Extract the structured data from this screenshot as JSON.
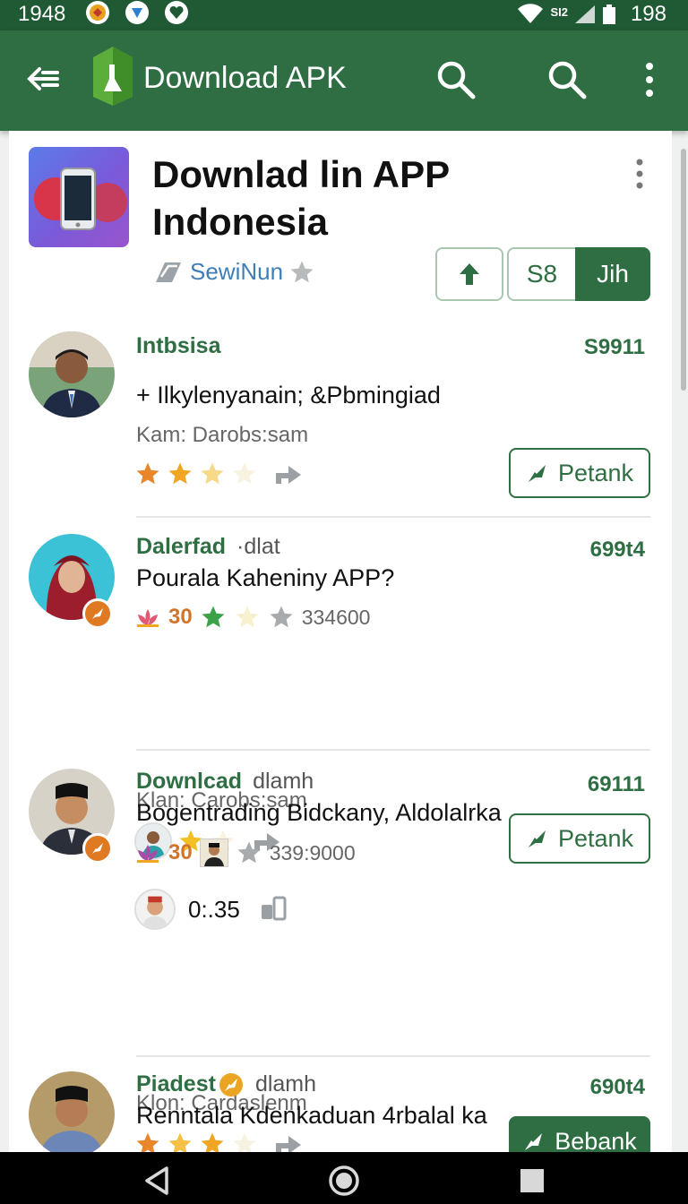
{
  "status": {
    "time": "1948",
    "signal_label": "SI2",
    "battery": "198"
  },
  "appbar": {
    "title": "Download APK"
  },
  "app": {
    "title_line1": "Downlad lin APP",
    "title_line2": "Indonesia",
    "developer": "SewiNun",
    "seg_2": "S8",
    "seg_3": "Jih"
  },
  "reviews": [
    {
      "name": "Intbsisa",
      "count": "S9911",
      "text": "+ Ilkylenyanain; &Pbmingiad",
      "meta": "Kam: Darobs:sam",
      "rating": 2.5,
      "button": "Petank"
    },
    {
      "name": "Dalerfad",
      "name_muted": "·dlat",
      "count": "699t4",
      "text": "Pourala Kaheniny APP?",
      "badge_count": "30",
      "sub_count": "334600",
      "meta": "Klan: Carobs:sam",
      "rating": 1.5,
      "button": "Petank"
    },
    {
      "name": "Downlcad",
      "name_muted": "dlamh",
      "count": "69111",
      "text": "Bogentrading Bidckany, Aldolalrka",
      "badge_count": "30",
      "sub_count": "339:9000",
      "timer": "0:.35",
      "meta": "Klon: Cardaslenm",
      "rating": 3,
      "button": "Bebank"
    },
    {
      "name": "Piadest",
      "name_muted": "dlamh",
      "count": "690t4",
      "text": "Renntala Kdenkaduan 4rbalal ka"
    }
  ],
  "colors": {
    "primary": "#2f6e43",
    "statusbar": "#1f5a34",
    "star": "#f0a623",
    "star_orange": "#e9862a",
    "developer": "#3f7fb7"
  },
  "icons": [
    "back-arrow-icon",
    "apk-logo-icon",
    "search-icon",
    "more-vert-icon",
    "star-icon",
    "share-icon",
    "send-icon",
    "verified-badge-icon",
    "nav-back-icon",
    "nav-home-icon",
    "nav-recents-icon"
  ]
}
